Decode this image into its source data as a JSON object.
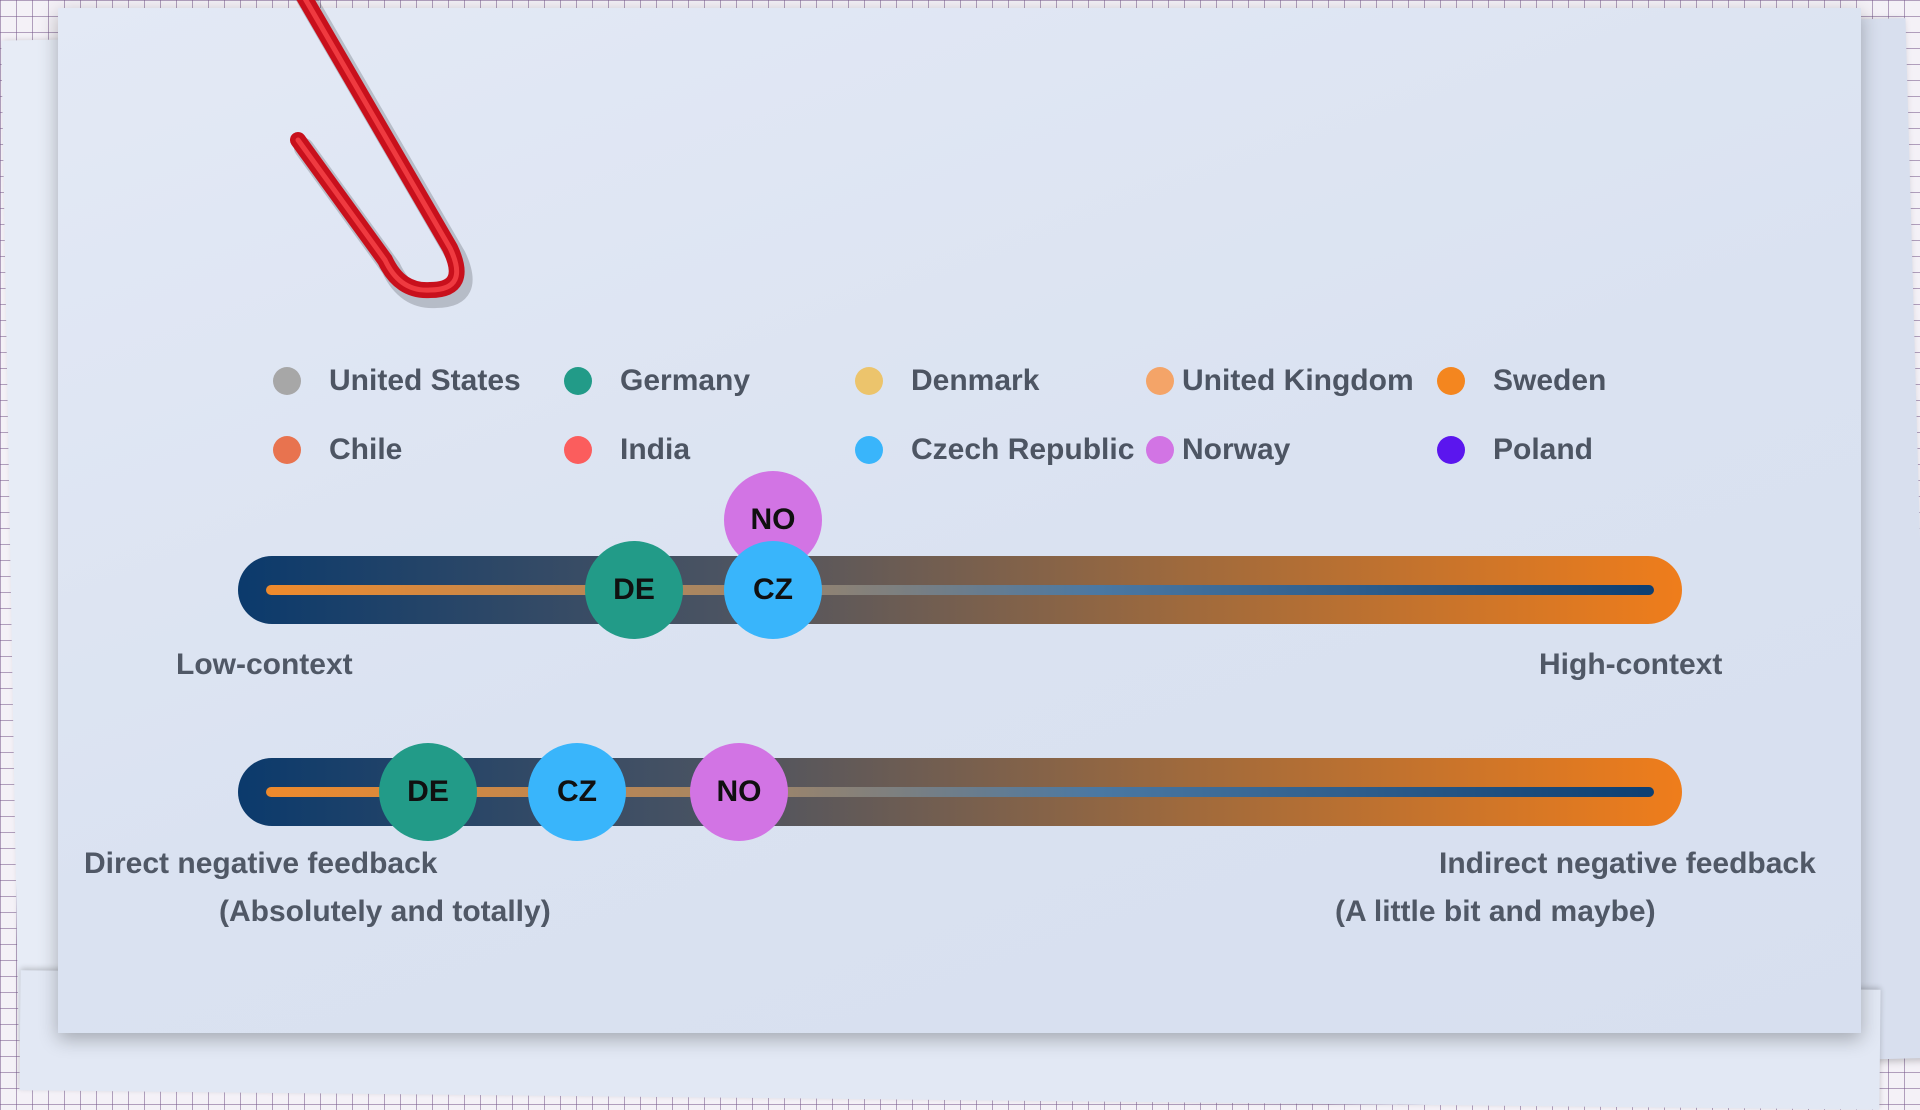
{
  "legend": [
    {
      "label": "United States",
      "color": "#a7a7a7"
    },
    {
      "label": "Germany",
      "color": "#229b88"
    },
    {
      "label": "Denmark",
      "color": "#ecc46c"
    },
    {
      "label": "United Kingdom",
      "color": "#f4a468"
    },
    {
      "label": "Sweden",
      "color": "#f4861f"
    },
    {
      "label": "Chile",
      "color": "#e8734f"
    },
    {
      "label": "India",
      "color": "#fb5d5d"
    },
    {
      "label": "Czech Republic",
      "color": "#39b5fb"
    },
    {
      "label": "Norway",
      "color": "#d274e4"
    },
    {
      "label": "Poland",
      "color": "#5b16ee"
    }
  ],
  "scales": [
    {
      "left_label": "Low-context",
      "right_label": "High-context",
      "markers": [
        {
          "code": "DE",
          "color": "#229b88"
        },
        {
          "code": "CZ",
          "color": "#39b5fb"
        },
        {
          "code": "NO",
          "color": "#d274e4"
        }
      ]
    },
    {
      "left_label": "Direct negative feedback",
      "left_sublabel": "(Absolutely and totally)",
      "right_label": "Indirect negative feedback",
      "right_sublabel": "(A little bit and maybe)",
      "markers": [
        {
          "code": "DE",
          "color": "#229b88"
        },
        {
          "code": "CZ",
          "color": "#39b5fb"
        },
        {
          "code": "NO",
          "color": "#d274e4"
        }
      ]
    }
  ]
}
